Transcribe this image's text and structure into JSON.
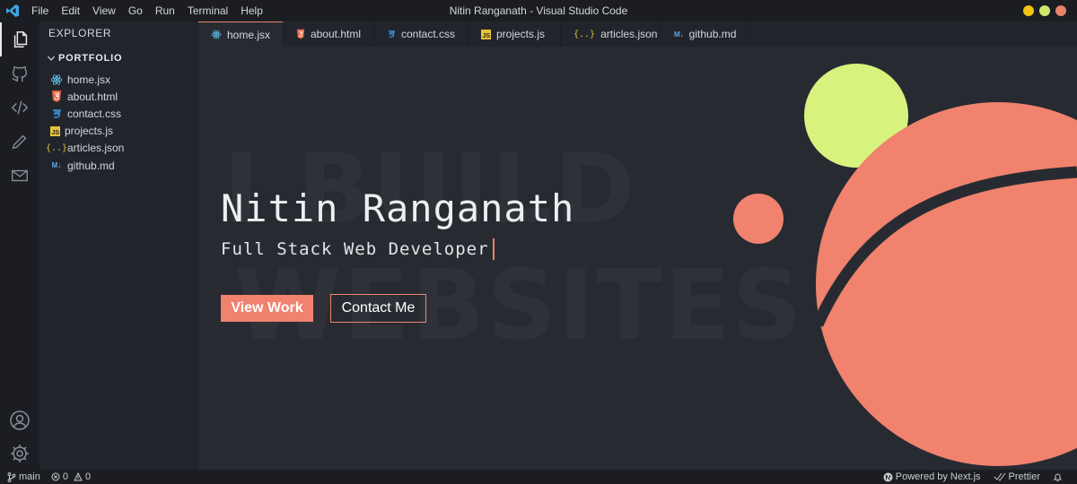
{
  "window": {
    "title": "Nitin Ranganath - Visual Studio Code",
    "menu": [
      "File",
      "Edit",
      "View",
      "Go",
      "Run",
      "Terminal",
      "Help"
    ],
    "controls": {
      "yellow": "#f1c40f",
      "green": "#cbe86b",
      "red": "#e8836c"
    }
  },
  "activity_bar": {
    "items": [
      "files-icon",
      "github-icon",
      "code-icon",
      "pencil-icon",
      "mail-icon"
    ],
    "bottom": [
      "account-icon",
      "settings-icon"
    ]
  },
  "sidebar": {
    "title": "EXPLORER",
    "folder": "PORTFOLIO",
    "files": [
      {
        "name": "home.jsx",
        "icon": "react-icon"
      },
      {
        "name": "about.html",
        "icon": "html-icon"
      },
      {
        "name": "contact.css",
        "icon": "css-icon"
      },
      {
        "name": "projects.js",
        "icon": "js-icon"
      },
      {
        "name": "articles.json",
        "icon": "json-icon"
      },
      {
        "name": "github.md",
        "icon": "markdown-icon"
      }
    ]
  },
  "tabs": [
    {
      "label": "home.jsx",
      "active": true
    },
    {
      "label": "about.html"
    },
    {
      "label": "contact.css"
    },
    {
      "label": "projects.js"
    },
    {
      "label": "articles.json"
    },
    {
      "label": "github.md"
    }
  ],
  "hero": {
    "background_text": [
      "I BUILD",
      "WEBSITES"
    ],
    "name": "Nitin Ranganath",
    "role": "Full Stack Web Developer",
    "primary_button": "View Work",
    "secondary_button": "Contact Me",
    "accent_color": "#f0826e",
    "lime_color": "#d8f27e"
  },
  "statusbar": {
    "branch": "main",
    "errors": "0",
    "warnings": "0",
    "powered_by": "Powered by Next.js",
    "formatter": "Prettier"
  }
}
